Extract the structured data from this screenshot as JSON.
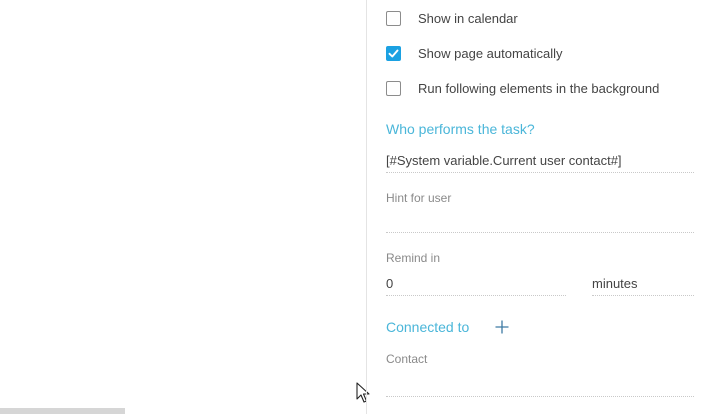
{
  "options": {
    "show_in_calendar": {
      "label": "Show in calendar",
      "checked": false
    },
    "show_page_automatically": {
      "label": "Show page automatically",
      "checked": true
    },
    "run_in_background": {
      "label": "Run following elements in the background",
      "checked": false
    }
  },
  "performer": {
    "title": "Who performs the task?",
    "value": "[#System variable.Current user contact#]"
  },
  "hint": {
    "label": "Hint for user",
    "value": ""
  },
  "remind": {
    "label": "Remind in",
    "value": "0",
    "unit": "minutes"
  },
  "connected": {
    "title": "Connected to",
    "add_icon": "plus-icon",
    "contact_label": "Contact",
    "contact_value": ""
  },
  "colors": {
    "accent": "#1ba1e2",
    "section_title": "#4ab6d9"
  }
}
